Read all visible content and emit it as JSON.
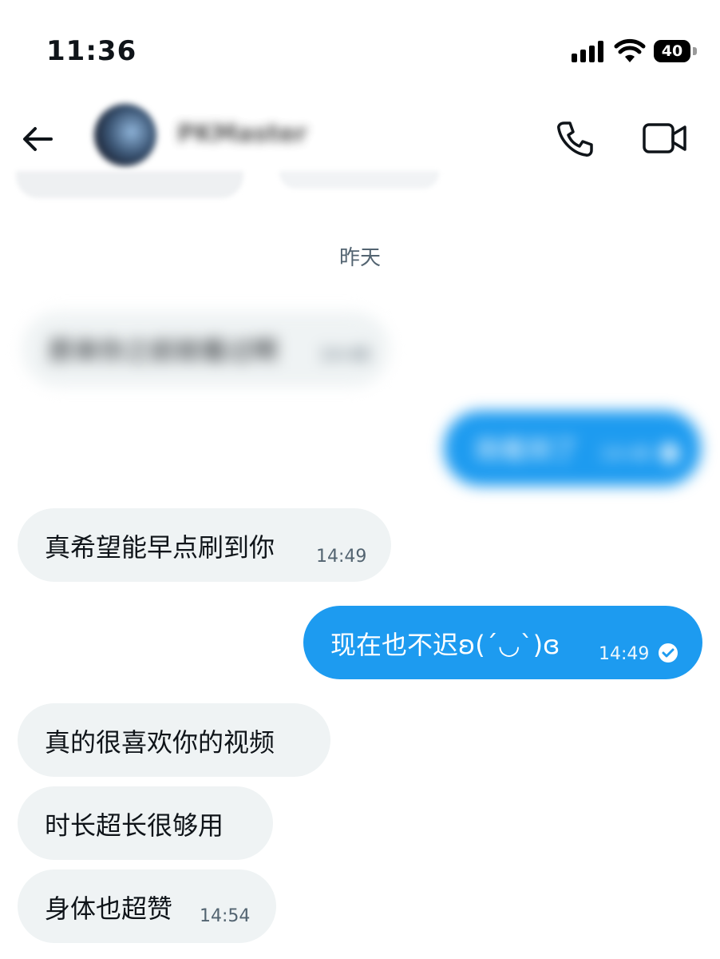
{
  "status_bar": {
    "time": "11:36",
    "battery": "40"
  },
  "header": {
    "contact_name": "PKMaster",
    "back_icon": "arrow-left-icon",
    "call_icon": "phone-icon",
    "video_icon": "video-camera-icon"
  },
  "date_separator": "昨天",
  "messages": [
    {
      "direction": "in",
      "text": "原来你之前就看过啊",
      "time": "14:48",
      "blurred": true
    },
    {
      "direction": "out",
      "text": "刚看到了",
      "time": "14:48",
      "blurred": true,
      "status": "read"
    },
    {
      "direction": "in",
      "text": "真希望能早点刷到你",
      "time": "14:49"
    },
    {
      "direction": "out",
      "text": "现在也不迟ʚ(´◡`)ɞ",
      "time": "14:49",
      "status": "read"
    },
    {
      "direction": "in",
      "text": "真的很喜欢你的视频",
      "time": ""
    },
    {
      "direction": "in",
      "text": "时长超长很够用",
      "time": ""
    },
    {
      "direction": "in",
      "text": "身体也超赞",
      "time": "14:54"
    }
  ],
  "colors": {
    "accent": "#1d9bf0",
    "incoming_bubble": "#eff3f4",
    "secondary_text": "#536471"
  }
}
